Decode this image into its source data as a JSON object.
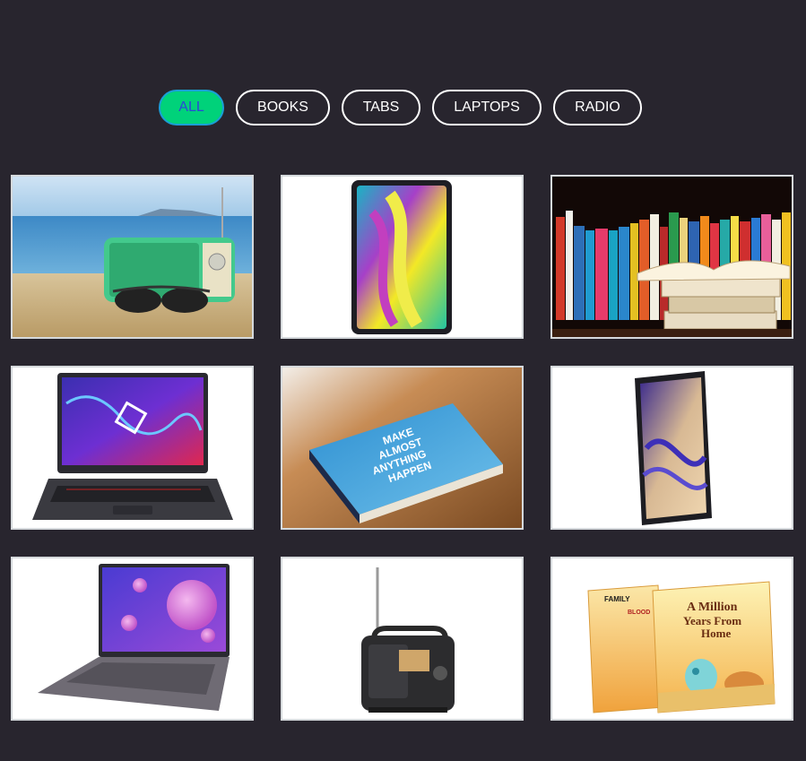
{
  "filters": [
    {
      "label": "ALL",
      "active": true
    },
    {
      "label": "BOOKS",
      "active": false
    },
    {
      "label": "TABS",
      "active": false
    },
    {
      "label": "LAPTOPS",
      "active": false
    },
    {
      "label": "RADIO",
      "active": false
    }
  ],
  "gallery": [
    {
      "category": "radio",
      "subject": "green retro radio with sunglasses on a beach"
    },
    {
      "category": "tabs",
      "subject": "tablet with colorful wallpaper"
    },
    {
      "category": "books",
      "subject": "bookshelf with stack of open books"
    },
    {
      "category": "laptops",
      "subject": "gaming laptop with purple screen"
    },
    {
      "category": "books",
      "subject": "hardcover book on wooden table",
      "cover_text": [
        "MAKE",
        "ALMOST",
        "ANYTHING",
        "HAPPEN"
      ]
    },
    {
      "category": "tabs",
      "subject": "black tablet with wavy wallpaper"
    },
    {
      "category": "laptops",
      "subject": "slim laptop with bubble wallpaper"
    },
    {
      "category": "radio",
      "subject": "portable black radio with antenna"
    },
    {
      "category": "books",
      "subject": "two illustrated children's books",
      "cover_text": [
        "A Million",
        "Years From",
        "Home",
        "FAMILY",
        "BLOOD"
      ]
    }
  ]
}
